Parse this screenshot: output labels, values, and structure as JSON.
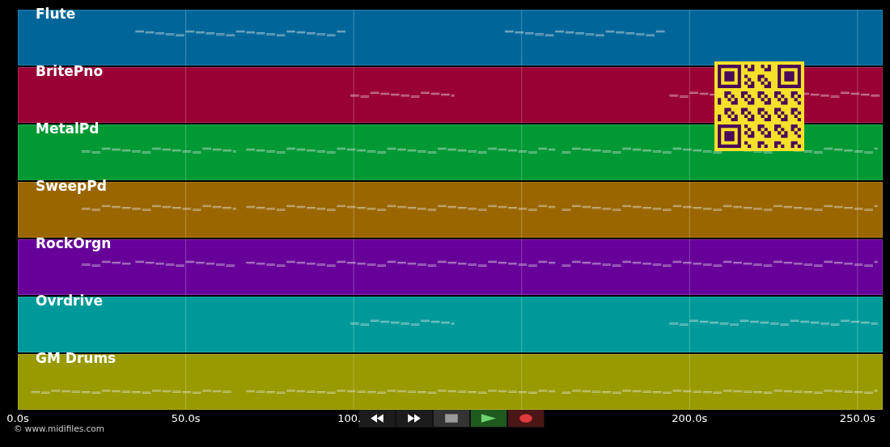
{
  "tracks": [
    {
      "name": "Flute",
      "color": "#006699"
    },
    {
      "name": "BritePno",
      "color": "#990033"
    },
    {
      "name": "MetalPd",
      "color": "#009933"
    },
    {
      "name": "SweepPd",
      "color": "#996600"
    },
    {
      "name": "RockOrgn",
      "color": "#660099"
    },
    {
      "name": "Ovrdrive",
      "color": "#009999"
    },
    {
      "name": "GM Drums",
      "color": "#999900"
    }
  ],
  "axis": {
    "ticks": [
      "0.0s",
      "50.0s",
      "100.",
      "200.0s",
      "250.0s"
    ]
  },
  "controls": [
    {
      "kind": "rewind"
    },
    {
      "kind": "forward"
    },
    {
      "kind": "stop"
    },
    {
      "kind": "play"
    },
    {
      "kind": "record"
    }
  ],
  "credit": "© www.midifiles.com"
}
